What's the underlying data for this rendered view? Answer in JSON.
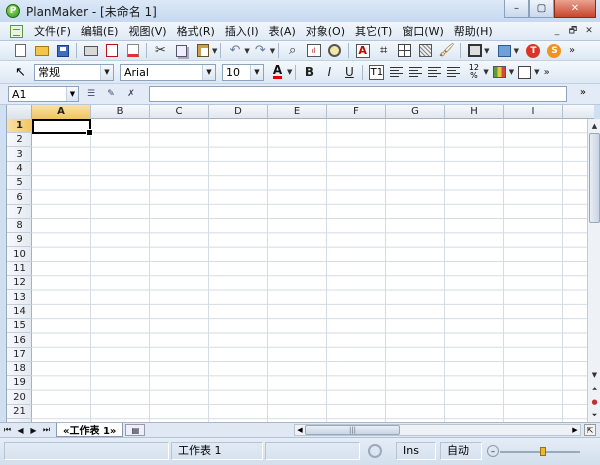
{
  "window": {
    "title": "PlanMaker - [未命名 1]",
    "app_icon_letter": "P",
    "minimize": "–",
    "maximize": "▢",
    "close": "✕"
  },
  "menu": {
    "items": [
      "文件(F)",
      "编辑(E)",
      "视图(V)",
      "格式(R)",
      "插入(I)",
      "表(A)",
      "对象(O)",
      "其它(T)",
      "窗口(W)",
      "帮助(H)"
    ],
    "mdi": {
      "minimize": "_",
      "restore": "🗗",
      "close": "✕"
    }
  },
  "format_toolbar": {
    "style": "常规",
    "font": "Arial",
    "size": "10",
    "font_color_letter": "A",
    "bold": "B",
    "italic": "I",
    "underline": "U",
    "t1": "T1",
    "numfmt": "12\n%",
    "font_color": "#e00000"
  },
  "formula": {
    "cell_ref": "A1",
    "input_value": ""
  },
  "columns": [
    "A",
    "B",
    "C",
    "D",
    "E",
    "F",
    "G",
    "H",
    "I"
  ],
  "rows": [
    "1",
    "2",
    "3",
    "4",
    "5",
    "6",
    "7",
    "8",
    "9",
    "10",
    "11",
    "12",
    "13",
    "14",
    "15",
    "16",
    "17",
    "18",
    "19",
    "20",
    "21"
  ],
  "active": {
    "column": "A",
    "row": "1"
  },
  "sheets": {
    "active_tab": "«工作表 1»",
    "nav": [
      "⏮",
      "◀",
      "▶",
      "⏭"
    ]
  },
  "status": {
    "sheet": "工作表 1",
    "mode": "Ins",
    "calc": "自动"
  },
  "icons": {
    "cut": "✂",
    "undo": "↶",
    "redo": "↷",
    "find": "⌕",
    "brush": "🖌"
  }
}
